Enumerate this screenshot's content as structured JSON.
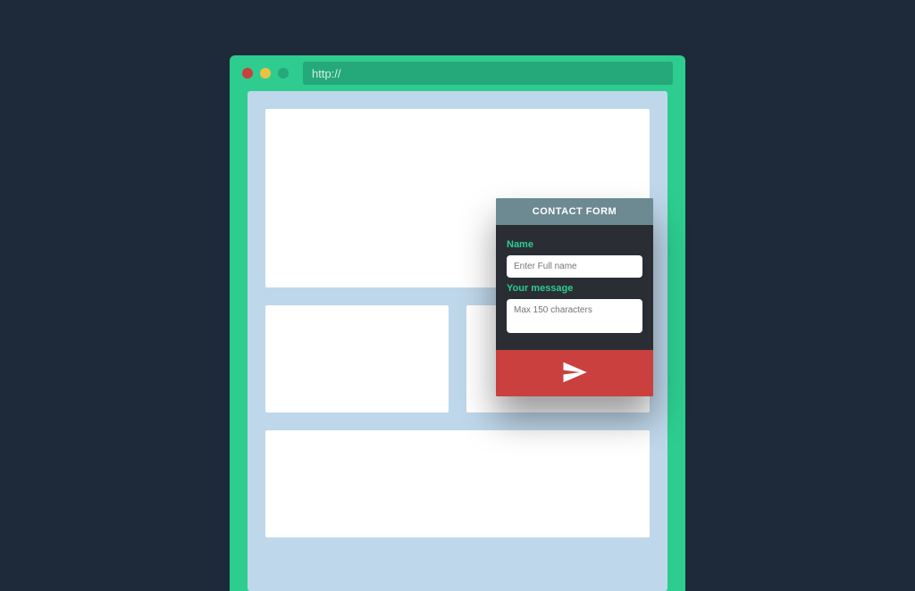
{
  "browser": {
    "address": "http://"
  },
  "contact_form": {
    "title": "CONTACT FORM",
    "name_label": "Name",
    "name_placeholder": "Enter Full name",
    "message_label": "Your message",
    "message_placeholder": "Max 150 characters"
  },
  "colors": {
    "page_bg": "#1e2a3a",
    "browser_bg": "#2ecc8f",
    "address_bg": "#25a87a",
    "viewport_bg": "#bfd7ea",
    "card_bg": "#ffffff",
    "panel_bg": "#2a2d34",
    "panel_header_bg": "#6d8a93",
    "accent": "#2ecc8f",
    "send_bg": "#c9403f"
  }
}
